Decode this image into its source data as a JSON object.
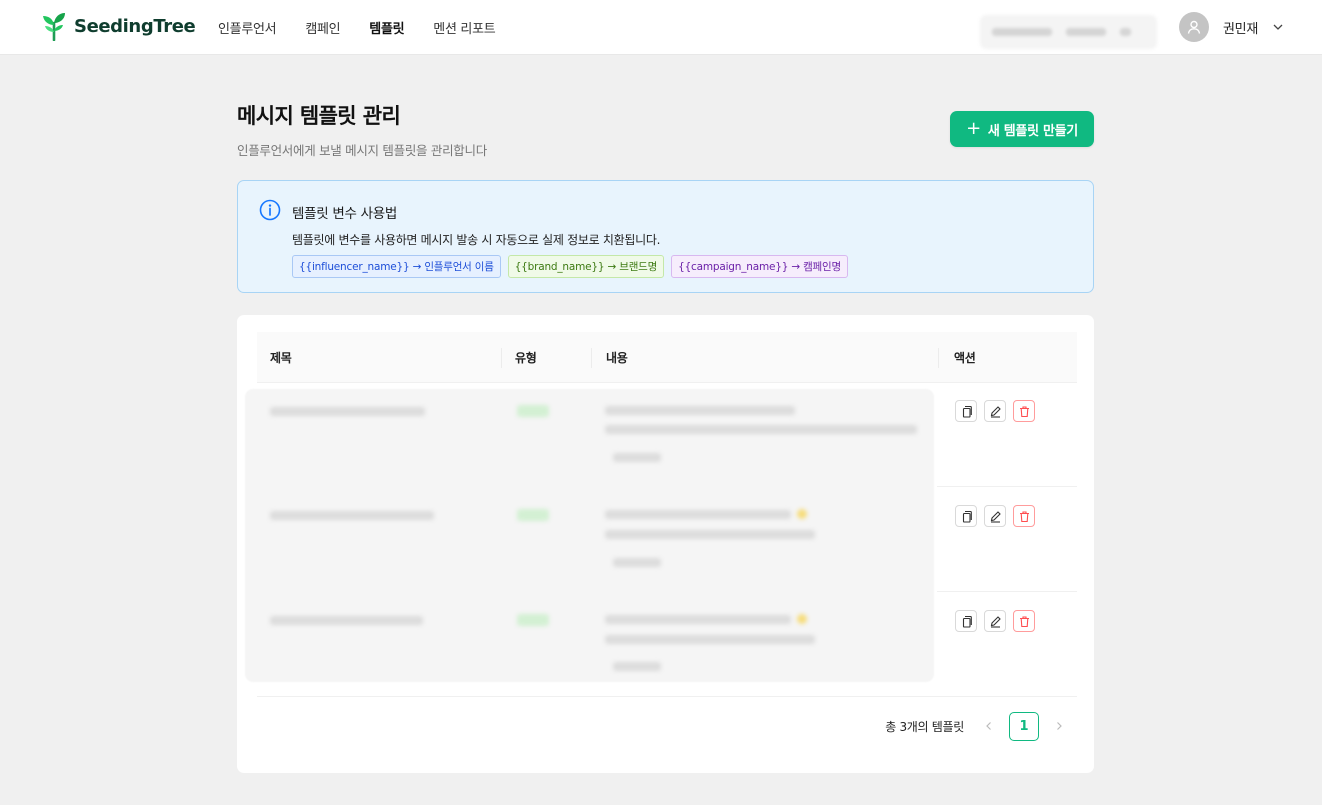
{
  "brand": {
    "name": "SeedingTree",
    "color": "#10b981"
  },
  "nav": {
    "items": [
      {
        "label": "인플루언서",
        "active": false
      },
      {
        "label": "캠페인",
        "active": false
      },
      {
        "label": "템플릿",
        "active": true
      },
      {
        "label": "멘션 리포트",
        "active": false
      }
    ]
  },
  "user": {
    "name": "권민재",
    "avatar_icon": "user-icon"
  },
  "page": {
    "title": "메시지 템플릿 관리",
    "subtitle": "인플루언서에게 보낼 메시지 템플릿을 관리합니다",
    "new_button_label": "새 템플릿 만들기"
  },
  "info": {
    "title": "템플릿 변수 사용법",
    "description": "템플릿에 변수를 사용하면 메시지 발송 시 자동으로 실제 정보로 치환됩니다.",
    "tags": [
      {
        "label": "{{influencer_name}} → 인플루언서 이름",
        "color": "blue"
      },
      {
        "label": "{{brand_name}} → 브랜드명",
        "color": "green"
      },
      {
        "label": "{{campaign_name}} → 캠페인명",
        "color": "purple"
      }
    ]
  },
  "table": {
    "columns": [
      "제목",
      "유형",
      "내용",
      "액션"
    ]
  },
  "pagination": {
    "total_label": "총 3개의 템플릿",
    "current_page": "1"
  }
}
